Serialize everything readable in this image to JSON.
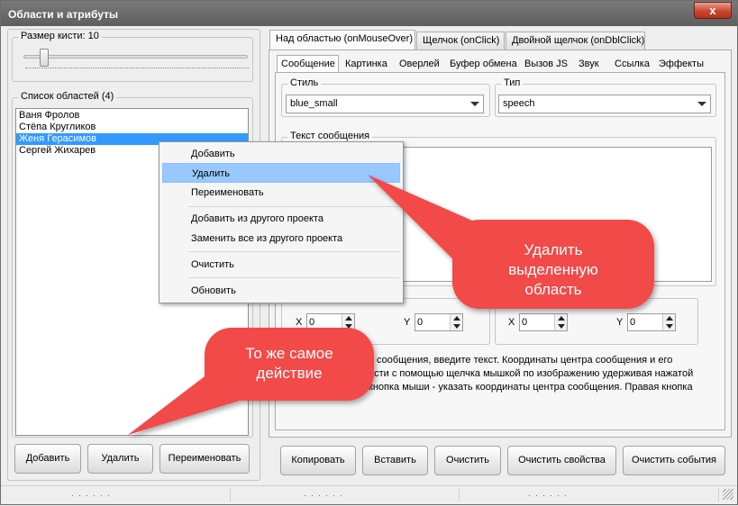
{
  "window": {
    "title": "Области и атрибуты",
    "close": "x"
  },
  "brush": {
    "label": "Размер кисти: 10",
    "value": 10
  },
  "areas": {
    "label": "Список областей (4)",
    "items": [
      "Ваня Фролов",
      "Стёпа Кругликов",
      "Женя Герасимов",
      "Сергей Жихарев"
    ],
    "selected_index": 2
  },
  "left_buttons": {
    "add": "Добавить",
    "delete": "Удалить",
    "rename": "Переименовать"
  },
  "tabs": [
    "Над областью (onMouseOver)",
    "Щелчок (onClick)",
    "Двойной щелчок (onDblClick)"
  ],
  "subtabs": [
    "Сообщение",
    "Картинка",
    "Оверлей",
    "Буфер обмена",
    "Вызов JS",
    "Звук",
    "Ссылка",
    "Эффекты"
  ],
  "style": {
    "label": "Стиль",
    "value": "blue_small"
  },
  "type": {
    "label": "Тип",
    "value": "speech"
  },
  "message": {
    "label": "Текст сообщения"
  },
  "coords": {
    "x1_label": "X",
    "x1": "0",
    "y1_label": "Y",
    "y1": "0",
    "x2_label": "X",
    "x2": "0",
    "y2_label": "Y",
    "y2": "0"
  },
  "hint": {
    "line1": "п сообщения, введите текст. Координаты центра сообщения и его",
    "line2": "ести с помощью щелчка мышкой по изображению удерживая нажатой",
    "line3": "кнопка мыши - указать координаты центра сообщения. Правая кнопка"
  },
  "right_buttons": {
    "copy": "Копировать",
    "paste": "Вставить",
    "clear": "Очистить",
    "clear_props": "Очистить свойства",
    "clear_events": "Очистить события"
  },
  "context_menu": {
    "add": "Добавить",
    "delete": "Удалить",
    "rename": "Переименовать",
    "add_from": "Добавить из другого проекта",
    "replace_from": "Заменить все из другого проекта",
    "clear": "Очистить",
    "refresh": "Обновить"
  },
  "callouts": {
    "delete_line1": "Удалить",
    "delete_line2": "выделенную",
    "delete_line3": "область",
    "same_line1": "То же самое",
    "same_line2": "действие"
  },
  "colors": {
    "callout": "#f24a4a",
    "selection": "#3399ff",
    "menu_highlight": "#98c8ff",
    "title_bar": "#6a6a6a"
  }
}
